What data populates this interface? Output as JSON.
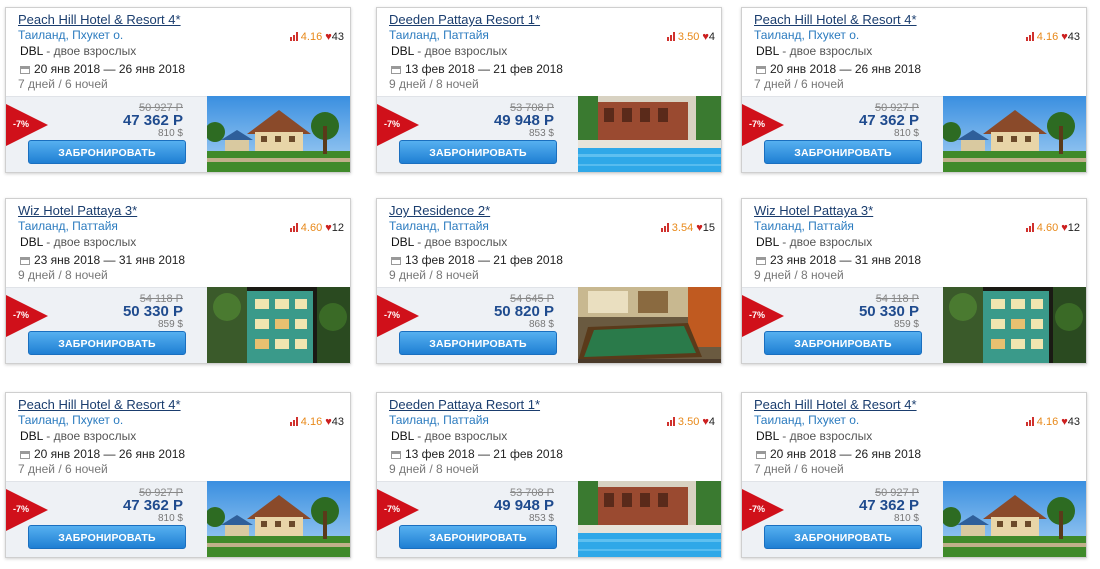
{
  "cards": [
    {
      "name": "Peach Hill Hotel & Resort 4*",
      "location": "Таиланд, Пхукет о.",
      "room_type": "DBL",
      "guests": " - двое взрослых",
      "dates": "20 янв 2018 — 26 янв 2018",
      "duration": "7 дней / 6 ночей",
      "rating": "4.16",
      "likes": "43",
      "discount": "-7%",
      "old_price": "50 927 Р",
      "price": "47 362 Р",
      "usd": "810 $",
      "button": "ЗАБРОНИРОВАТЬ",
      "photo": "resort"
    },
    {
      "name": "Deeden Pattaya Resort 1*",
      "location": "Таиланд, Паттайя",
      "room_type": "DBL",
      "guests": " - двое взрослых",
      "dates": "13 фев 2018 — 21 фев 2018",
      "duration": "9 дней / 8 ночей",
      "rating": "3.50",
      "likes": "4",
      "discount": "-7%",
      "old_price": "53 708 Р",
      "price": "49 948 Р",
      "usd": "853 $",
      "button": "ЗАБРОНИРОВАТЬ",
      "photo": "pool"
    },
    {
      "name": "Peach Hill Hotel & Resort 4*",
      "location": "Таиланд, Пхукет о.",
      "room_type": "DBL",
      "guests": " - двое взрослых",
      "dates": "20 янв 2018 — 26 янв 2018",
      "duration": "7 дней / 6 ночей",
      "rating": "4.16",
      "likes": "43",
      "discount": "-7%",
      "old_price": "50 927 Р",
      "price": "47 362 Р",
      "usd": "810 $",
      "button": "ЗАБРОНИРОВАТЬ",
      "photo": "resort"
    },
    {
      "name": "Wiz Hotel Pattaya 3*",
      "location": "Таиланд, Паттайя",
      "room_type": "DBL",
      "guests": " - двое взрослых",
      "dates": "23 янв 2018 — 31 янв 2018",
      "duration": "9 дней / 8 ночей",
      "rating": "4.60",
      "likes": "12",
      "discount": "-7%",
      "old_price": "54 118 Р",
      "price": "50 330 Р",
      "usd": "859 $",
      "button": "ЗАБРОНИРОВАТЬ",
      "photo": "building"
    },
    {
      "name": "Joy Residence 2*",
      "location": "Таиланд, Паттайя",
      "room_type": "DBL",
      "guests": " - двое взрослых",
      "dates": "13 фев 2018 — 21 фев 2018",
      "duration": "9 дней / 8 ночей",
      "rating": "3.54",
      "likes": "15",
      "discount": "-7%",
      "old_price": "54 645 Р",
      "price": "50 820 Р",
      "usd": "868 $",
      "button": "ЗАБРОНИРОВАТЬ",
      "photo": "billiard"
    },
    {
      "name": "Wiz Hotel Pattaya 3*",
      "location": "Таиланд, Паттайя",
      "room_type": "DBL",
      "guests": " - двое взрослых",
      "dates": "23 янв 2018 — 31 янв 2018",
      "duration": "9 дней / 8 ночей",
      "rating": "4.60",
      "likes": "12",
      "discount": "-7%",
      "old_price": "54 118 Р",
      "price": "50 330 Р",
      "usd": "859 $",
      "button": "ЗАБРОНИРОВАТЬ",
      "photo": "building"
    },
    {
      "name": "Peach Hill Hotel & Resort 4*",
      "location": "Таиланд, Пхукет о.",
      "room_type": "DBL",
      "guests": " - двое взрослых",
      "dates": "20 янв 2018 — 26 янв 2018",
      "duration": "7 дней / 6 ночей",
      "rating": "4.16",
      "likes": "43",
      "discount": "-7%",
      "old_price": "50 927 Р",
      "price": "47 362 Р",
      "usd": "810 $",
      "button": "ЗАБРОНИРОВАТЬ",
      "photo": "resort"
    },
    {
      "name": "Deeden Pattaya Resort 1*",
      "location": "Таиланд, Паттайя",
      "room_type": "DBL",
      "guests": " - двое взрослых",
      "dates": "13 фев 2018 — 21 фев 2018",
      "duration": "9 дней / 8 ночей",
      "rating": "3.50",
      "likes": "4",
      "discount": "-7%",
      "old_price": "53 708 Р",
      "price": "49 948 Р",
      "usd": "853 $",
      "button": "ЗАБРОНИРОВАТЬ",
      "photo": "pool"
    },
    {
      "name": "Peach Hill Hotel & Resort 4*",
      "location": "Таиланд, Пхукет о.",
      "room_type": "DBL",
      "guests": " - двое взрослых",
      "dates": "20 янв 2018 — 26 янв 2018",
      "duration": "7 дней / 6 ночей",
      "rating": "4.16",
      "likes": "43",
      "discount": "-7%",
      "old_price": "50 927 Р",
      "price": "47 362 Р",
      "usd": "810 $",
      "button": "ЗАБРОНИРОВАТЬ",
      "photo": "resort"
    }
  ],
  "colors": {
    "accent": "#2b7bbf",
    "button": "#1f7fd3",
    "discount": "#d0101a",
    "price": "#1f4b8e",
    "rating": "#e8891a"
  }
}
